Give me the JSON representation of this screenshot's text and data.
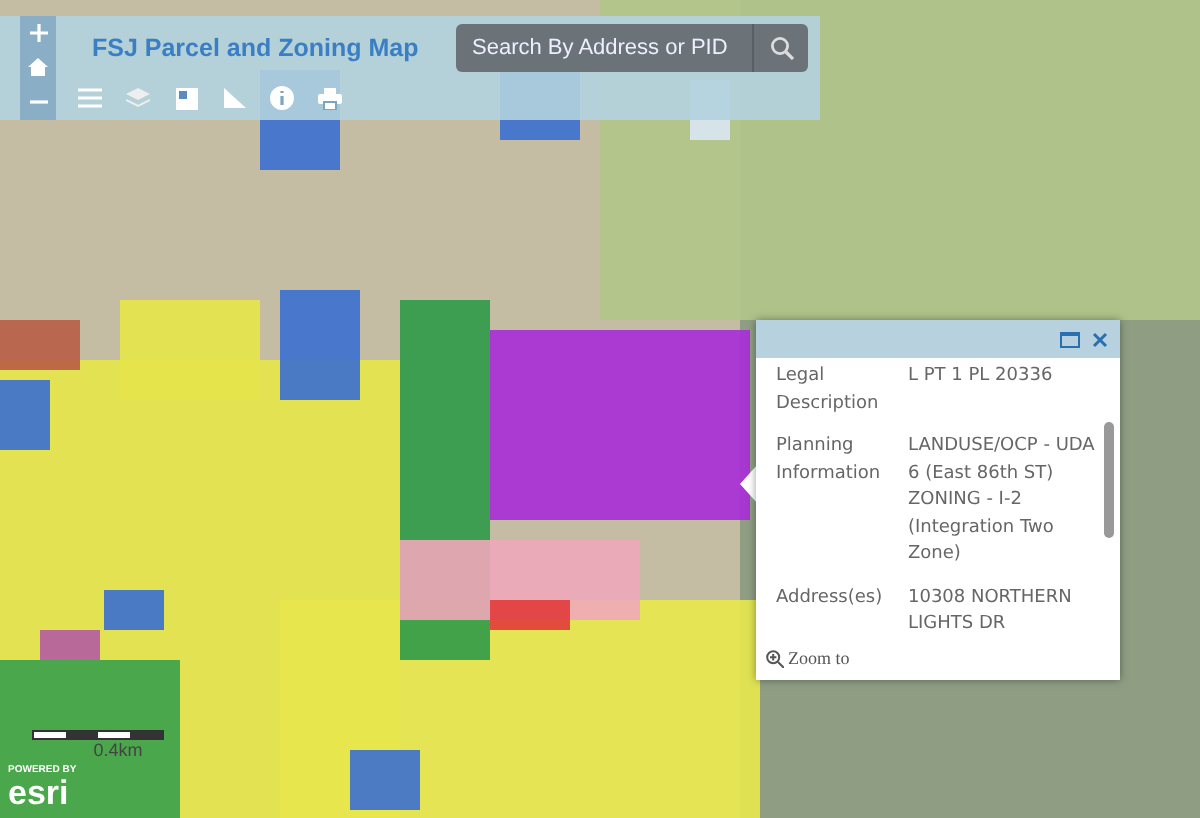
{
  "header": {
    "title": "FSJ Parcel and Zoning Map",
    "search": {
      "placeholder": "Search By Address or PID"
    }
  },
  "popup": {
    "rows": [
      {
        "label": "Legal Description",
        "values": [
          "L PT 1 PL 20336"
        ]
      },
      {
        "label": "Planning Information",
        "values": [
          "LANDUSE/OCP - UDA 6 (East 86th ST)",
          "ZONING - I-2 (Integration Two Zone)"
        ]
      },
      {
        "label": "Address(es)",
        "values": [
          "10308 NORTHERN LIGHTS DR"
        ]
      }
    ],
    "action": "Zoom to"
  },
  "scale_bar": {
    "label": "0.4km"
  },
  "attribution": {
    "line_1": "POWERED BY",
    "line_2": "esri"
  }
}
